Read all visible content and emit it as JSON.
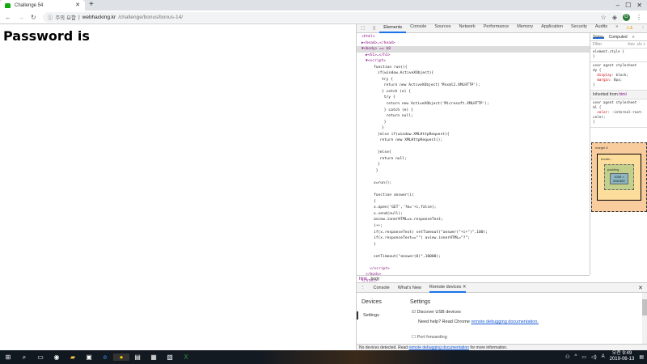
{
  "browser": {
    "tab_title": "Challenge 54",
    "security_label": "주의 요함",
    "url_host": "webhacking.kr",
    "url_path": "/challenge/bonus/bonus-14/",
    "avatar": "G"
  },
  "page": {
    "heading": "Password is"
  },
  "devtools": {
    "tabs": [
      "Elements",
      "Console",
      "Sources",
      "Network",
      "Performance",
      "Memory",
      "Application",
      "Security",
      "Audits",
      "»"
    ],
    "warning_count": "1",
    "dom_lines": [
      {
        "i": 0,
        "t": "<html>",
        "k": "tag"
      },
      {
        "i": 0,
        "t": "▶<head>…</head>",
        "k": "tag"
      },
      {
        "i": 0,
        "t": "▼<body> == $0",
        "k": "sel"
      },
      {
        "i": 1,
        "t": "▶<h1>…</h1>",
        "k": "tag"
      },
      {
        "i": 1,
        "t": "▼<script>",
        "k": "tag"
      },
      {
        "i": 3,
        "t": "function run(){",
        "k": "c"
      },
      {
        "i": 4,
        "t": "if(window.ActiveXObject){",
        "k": "c"
      },
      {
        "i": 5,
        "t": "try {",
        "k": "c"
      },
      {
        "i": 5,
        "t": " return new ActiveXObject('Msxml2.XMLHTTP');",
        "k": "c"
      },
      {
        "i": 5,
        "t": "} catch (e) {",
        "k": "c"
      },
      {
        "i": 5,
        "t": " try {",
        "k": "c"
      },
      {
        "i": 5,
        "t": "  return new ActiveXObject('Microsoft.XMLHTTP');",
        "k": "c"
      },
      {
        "i": 5,
        "t": " } catch (e) {",
        "k": "c"
      },
      {
        "i": 5,
        "t": "  return null;",
        "k": "c"
      },
      {
        "i": 5,
        "t": " }",
        "k": "c"
      },
      {
        "i": 5,
        "t": "}",
        "k": "c"
      },
      {
        "i": 4,
        "t": "}else if(window.XMLHttpRequest){",
        "k": "c"
      },
      {
        "i": 4,
        "t": " return new XMLHttpRequest();",
        "k": "c"
      },
      {
        "i": 4,
        "t": "",
        "k": "c"
      },
      {
        "i": 4,
        "t": "}else{",
        "k": "c"
      },
      {
        "i": 4,
        "t": " return null;",
        "k": "c"
      },
      {
        "i": 4,
        "t": "}",
        "k": "c"
      },
      {
        "i": 3,
        "t": " }",
        "k": "c"
      },
      {
        "i": 3,
        "t": "",
        "k": "c"
      },
      {
        "i": 3,
        "t": "x=run();",
        "k": "c"
      },
      {
        "i": 3,
        "t": "",
        "k": "c"
      },
      {
        "i": 3,
        "t": "function answer(i)",
        "k": "c"
      },
      {
        "i": 3,
        "t": "{",
        "k": "c"
      },
      {
        "i": 3,
        "t": "x.open('GET','?m='+i,false);",
        "k": "c"
      },
      {
        "i": 3,
        "t": "x.send(null);",
        "k": "c"
      },
      {
        "i": 3,
        "t": "aview.innerHTML=x.responseText;",
        "k": "c"
      },
      {
        "i": 3,
        "t": "i++;",
        "k": "c"
      },
      {
        "i": 3,
        "t": "if(x.responseText) setTimeout(\"answer(\"+i+\")\",100);",
        "k": "c"
      },
      {
        "i": 3,
        "t": "if(x.responseText==\"\") aview.innerHTML=\"?\";",
        "k": "c"
      },
      {
        "i": 3,
        "t": "}",
        "k": "c"
      },
      {
        "i": 3,
        "t": "",
        "k": "c"
      },
      {
        "i": 3,
        "t": "setTimeout(\"answer(0)\",10000);",
        "k": "c"
      },
      {
        "i": 3,
        "t": "",
        "k": "c"
      },
      {
        "i": 2,
        "t": "</script>",
        "k": "tag"
      },
      {
        "i": 1,
        "t": "</body>",
        "k": "tag"
      },
      {
        "i": 0,
        "t": "</html>",
        "k": "tag"
      }
    ],
    "styles": {
      "tabs": [
        "Styles",
        "Computed",
        "»"
      ],
      "filter_placeholder": "Filter",
      "hov": ":hov",
      ".cls": ".cls",
      "element_style": "element.style {",
      "close": "}",
      "ua_label": "user agent stylesheet",
      "ua_selector": "dy {",
      "display": "display",
      "display_val": "block;",
      "margin": "margin",
      "margin_val": "8px;",
      "inherited_label": "Inherited from",
      "inherited_tag": "html",
      "ua2_selector": "ml {",
      "color": "color",
      "color_val": "-internal-root-color;",
      "box": {
        "margin_label": "margin",
        "margin": "8",
        "border_label": "border",
        "border": "-",
        "padding_label": "padding",
        "padding": "-",
        "content": "1039 × 808.880"
      }
    },
    "breadcrumbs": [
      "html",
      "body"
    ],
    "drawer": {
      "tabs": [
        "Console",
        "What's New",
        "Remote devices"
      ],
      "sidebar": [
        "Devices",
        "Settings"
      ],
      "title": "Settings",
      "discover_usb": "Discover USB devices",
      "help_prefix": "Need help? Read Chrome",
      "help_link": "remote debugging documentation.",
      "port_forwarding": "Port forwarding"
    },
    "status": {
      "prefix": "No devices detected. Read",
      "link": "remote debugging documentation",
      "suffix": "for more information."
    }
  },
  "taskbar": {
    "time": "오전 9:49",
    "date": "2019-06-13",
    "ime": "A"
  }
}
